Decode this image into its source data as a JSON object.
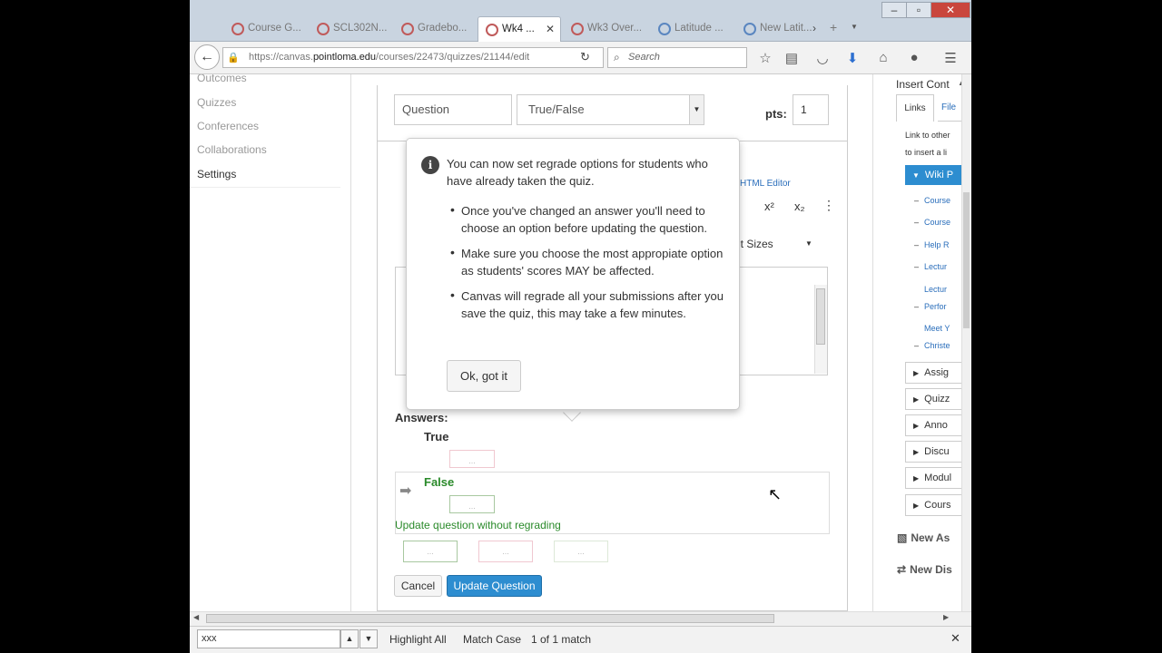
{
  "browser": {
    "tabs": [
      {
        "label": "Course G..."
      },
      {
        "label": "SCL302N..."
      },
      {
        "label": "Gradebo..."
      },
      {
        "label": "Wk4 ..."
      },
      {
        "label": "Wk3 Over..."
      },
      {
        "label": "Latitude ..."
      },
      {
        "label": "New Latit..."
      }
    ],
    "tab_close": "✕",
    "url_host": "https://canvas.",
    "url_domain": "pointloma.edu",
    "url_path": "/courses/22473/quizzes/21144/edit",
    "search_placeholder": "Search"
  },
  "sidebar": {
    "items": [
      "Outcomes",
      "Quizzes",
      "Conferences",
      "Collaborations",
      "Settings"
    ]
  },
  "question": {
    "name": "Question",
    "type": "True/False",
    "pts_label": "pts:",
    "pts_value": "1"
  },
  "editor": {
    "html_editor_link": "HTML Editor",
    "font_sizes": "nt Sizes",
    "sup": "x²",
    "sub": "x₂"
  },
  "answers": {
    "label": "Answers:",
    "true_label": "True",
    "false_label": "False",
    "regrade_text": "Update question without regrading",
    "box_text": "..."
  },
  "buttons": {
    "cancel": "Cancel",
    "update": "Update Question"
  },
  "popover": {
    "intro": "You can now set regrade options for students who have already taken the quiz.",
    "bullets": [
      "Once you've changed an answer you'll need to choose an option before updating the question.",
      "Make sure you choose the most appropiate option as students' scores MAY be affected.",
      "Canvas will regrade all your submissions after you save the quiz, this may take a few minutes."
    ],
    "ok": "Ok, got it"
  },
  "right_panel": {
    "title": "Insert Cont",
    "tab_links": "Links",
    "tab_files": "File",
    "help_line1": "Link to other",
    "help_line2": "to insert a li",
    "wiki_header": "Wiki P",
    "wiki_items": [
      "Course",
      "Course",
      "Help R",
      "Lectur",
      "Lectur",
      "Perfor",
      "Meet Y",
      "Christe"
    ],
    "accordion": [
      "Assig",
      "Quizz",
      "Anno",
      "Discu",
      "Modul",
      "Cours"
    ],
    "new_assignment": "New As",
    "new_discussion": "New Dis"
  },
  "findbar": {
    "query": "xxx",
    "highlight_all": "Highlight All",
    "match_case": "Match Case",
    "match_count": "1 of 1 match"
  },
  "colors": {
    "accent": "#2d8dd0",
    "correct": "#2a8a2a",
    "close": "#c9463d"
  }
}
